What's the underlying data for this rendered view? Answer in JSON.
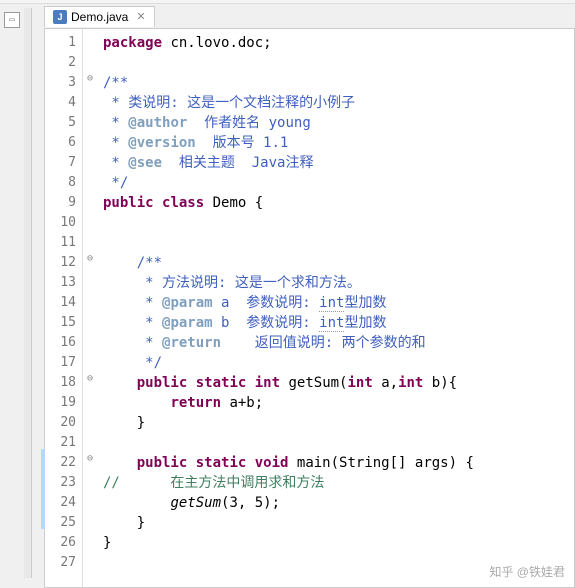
{
  "tab": {
    "filename": "Demo.java"
  },
  "code": {
    "lines": [
      {
        "n": 1,
        "fold": "",
        "hl": false,
        "parts": [
          [
            "kw",
            "package"
          ],
          [
            "norm",
            " cn.lovo.doc;"
          ]
        ]
      },
      {
        "n": 2,
        "fold": "",
        "hl": false,
        "parts": []
      },
      {
        "n": 3,
        "fold": "⊖",
        "hl": false,
        "parts": [
          [
            "doc",
            "/**"
          ]
        ]
      },
      {
        "n": 4,
        "fold": "",
        "hl": false,
        "parts": [
          [
            "doc",
            " * 类说明: 这是一个文档注释的小例子"
          ]
        ]
      },
      {
        "n": 5,
        "fold": "",
        "hl": false,
        "parts": [
          [
            "doc",
            " * "
          ],
          [
            "doctag",
            "@author"
          ],
          [
            "doc",
            "  作者姓名 young"
          ]
        ]
      },
      {
        "n": 6,
        "fold": "",
        "hl": false,
        "parts": [
          [
            "doc",
            " * "
          ],
          [
            "doctag",
            "@version"
          ],
          [
            "doc",
            "  版本号 1.1"
          ]
        ]
      },
      {
        "n": 7,
        "fold": "",
        "hl": false,
        "parts": [
          [
            "doc",
            " * "
          ],
          [
            "doctag",
            "@see"
          ],
          [
            "doc",
            "  相关主题  Java注释"
          ]
        ]
      },
      {
        "n": 8,
        "fold": "",
        "hl": false,
        "parts": [
          [
            "doc",
            " */"
          ]
        ]
      },
      {
        "n": 9,
        "fold": "",
        "hl": false,
        "parts": [
          [
            "kw",
            "public"
          ],
          [
            "norm",
            " "
          ],
          [
            "kw",
            "class"
          ],
          [
            "norm",
            " Demo {"
          ]
        ]
      },
      {
        "n": 10,
        "fold": "",
        "hl": false,
        "parts": []
      },
      {
        "n": 11,
        "fold": "",
        "hl": false,
        "parts": []
      },
      {
        "n": 12,
        "fold": "⊖",
        "hl": false,
        "parts": [
          [
            "doc",
            "    /**"
          ]
        ]
      },
      {
        "n": 13,
        "fold": "",
        "hl": false,
        "parts": [
          [
            "doc",
            "     * 方法说明: 这是一个求和方法。"
          ]
        ]
      },
      {
        "n": 14,
        "fold": "",
        "hl": false,
        "parts": [
          [
            "doc",
            "     * "
          ],
          [
            "doctag",
            "@param"
          ],
          [
            "doc",
            " a  参数说明: "
          ],
          [
            "doc-dotted",
            "int"
          ],
          [
            "doc",
            "型加数"
          ]
        ]
      },
      {
        "n": 15,
        "fold": "",
        "hl": false,
        "parts": [
          [
            "doc",
            "     * "
          ],
          [
            "doctag",
            "@param"
          ],
          [
            "doc",
            " b  参数说明: "
          ],
          [
            "doc-dotted",
            "int"
          ],
          [
            "doc",
            "型加数"
          ]
        ]
      },
      {
        "n": 16,
        "fold": "",
        "hl": false,
        "parts": [
          [
            "doc",
            "     * "
          ],
          [
            "doctag",
            "@return"
          ],
          [
            "doc",
            "    返回值说明: 两个参数的和"
          ]
        ]
      },
      {
        "n": 17,
        "fold": "",
        "hl": false,
        "parts": [
          [
            "doc",
            "     */"
          ]
        ]
      },
      {
        "n": 18,
        "fold": "⊖",
        "hl": false,
        "parts": [
          [
            "norm",
            "    "
          ],
          [
            "kw",
            "public"
          ],
          [
            "norm",
            " "
          ],
          [
            "kw",
            "static"
          ],
          [
            "norm",
            " "
          ],
          [
            "kw",
            "int"
          ],
          [
            "norm",
            " getSum("
          ],
          [
            "kw",
            "int"
          ],
          [
            "norm",
            " a,"
          ],
          [
            "kw",
            "int"
          ],
          [
            "norm",
            " b){"
          ]
        ]
      },
      {
        "n": 19,
        "fold": "",
        "hl": false,
        "parts": [
          [
            "norm",
            "        "
          ],
          [
            "kw",
            "return"
          ],
          [
            "norm",
            " a+b;"
          ]
        ]
      },
      {
        "n": 20,
        "fold": "",
        "hl": false,
        "parts": [
          [
            "norm",
            "    }"
          ]
        ]
      },
      {
        "n": 21,
        "fold": "",
        "hl": false,
        "parts": []
      },
      {
        "n": 22,
        "fold": "⊖",
        "hl": true,
        "parts": [
          [
            "norm",
            "    "
          ],
          [
            "kw",
            "public"
          ],
          [
            "norm",
            " "
          ],
          [
            "kw",
            "static"
          ],
          [
            "norm",
            " "
          ],
          [
            "kw",
            "void"
          ],
          [
            "norm",
            " main(String[] args) {"
          ]
        ]
      },
      {
        "n": 23,
        "fold": "",
        "hl": true,
        "parts": [
          [
            "cmt",
            "//      在主方法中调用求和方法"
          ]
        ]
      },
      {
        "n": 24,
        "fold": "",
        "hl": true,
        "parts": [
          [
            "norm",
            "        "
          ],
          [
            "norm-italic",
            "getSum"
          ],
          [
            "norm",
            "(3, 5);"
          ]
        ]
      },
      {
        "n": 25,
        "fold": "",
        "hl": true,
        "parts": [
          [
            "norm",
            "    }"
          ]
        ]
      },
      {
        "n": 26,
        "fold": "",
        "hl": false,
        "parts": [
          [
            "norm",
            "}"
          ]
        ]
      },
      {
        "n": 27,
        "fold": "",
        "hl": false,
        "parts": []
      }
    ]
  },
  "watermark": "知乎 @铁娃君"
}
